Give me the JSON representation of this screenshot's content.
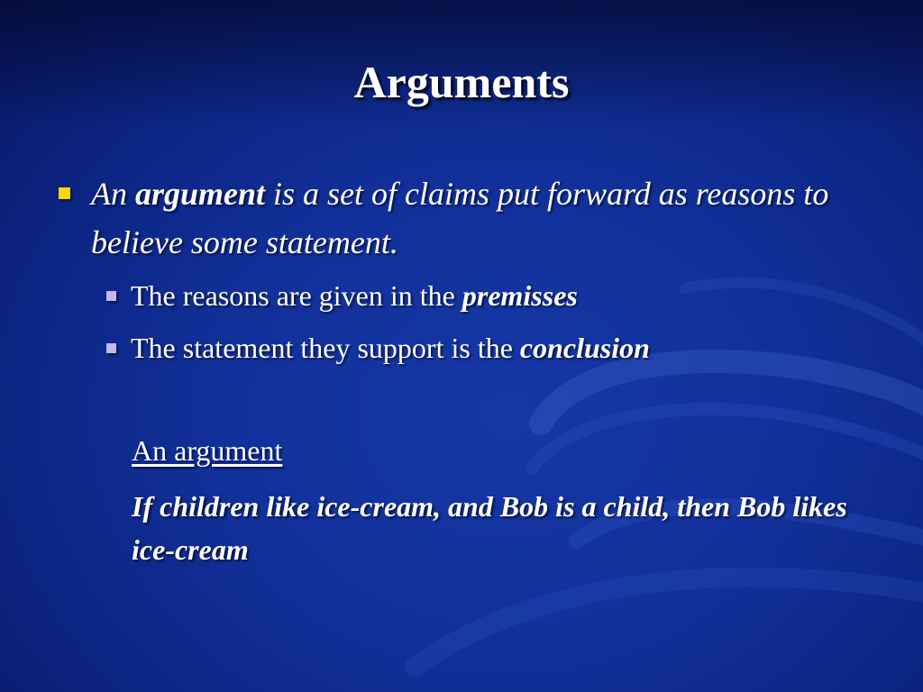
{
  "slide": {
    "title": "Arguments",
    "bullet1": {
      "pre": "An ",
      "bold": "argument",
      "post": " is a set of claims put forward as reasons to believe some statement."
    },
    "sub_bullets": [
      {
        "pre": "The reasons are given in the ",
        "term": "premisses"
      },
      {
        "pre": "The statement they support is the ",
        "term": "conclusion"
      }
    ],
    "example": {
      "heading": "An argument",
      "text": "If children like ice-cream, and Bob is a child, then Bob likes ice-cream"
    }
  },
  "colors": {
    "background": "#12309a",
    "primary_bullet": "#ffd700",
    "secondary_bullet": "#c4b8ea",
    "text": "#ffffff"
  }
}
